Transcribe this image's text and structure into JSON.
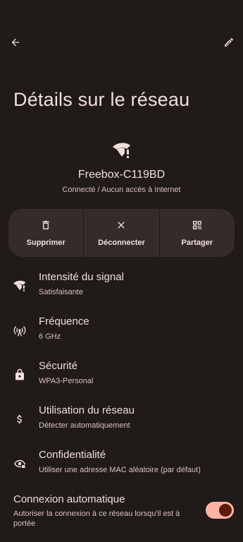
{
  "page": {
    "title": "Détails sur le réseau",
    "ssid": "Freebox-C119BD",
    "status": "Connecté / Aucun accès à Internet"
  },
  "actions": [
    {
      "label": "Supprimer",
      "icon": "trash-icon"
    },
    {
      "label": "Déconnecter",
      "icon": "close-icon"
    },
    {
      "label": "Partager",
      "icon": "qr-code-icon"
    }
  ],
  "details": [
    {
      "title": "Intensité du signal",
      "value": "Satisfaisante",
      "icon": "wifi-warning-icon"
    },
    {
      "title": "Fréquence",
      "value": "6 GHz",
      "icon": "antenna-icon"
    },
    {
      "title": "Sécurité",
      "value": "WPA3-Personal",
      "icon": "lock-icon"
    },
    {
      "title": "Utilisation du réseau",
      "value": "Détecter automatiquement",
      "icon": "dollar-icon"
    },
    {
      "title": "Confidentialité",
      "value": "Utiliser une adresse MAC aléatoire (par défaut)",
      "icon": "privacy-eye-icon"
    }
  ],
  "auto_connect": {
    "title": "Connexion automatique",
    "description": "Autoriser la connexion à ce réseau lorsqu'il est à portée",
    "enabled": true
  },
  "colors": {
    "background": "#201a19",
    "card": "#352c2a",
    "accent": "#ffb4a4",
    "text": "#f1dfdc"
  }
}
